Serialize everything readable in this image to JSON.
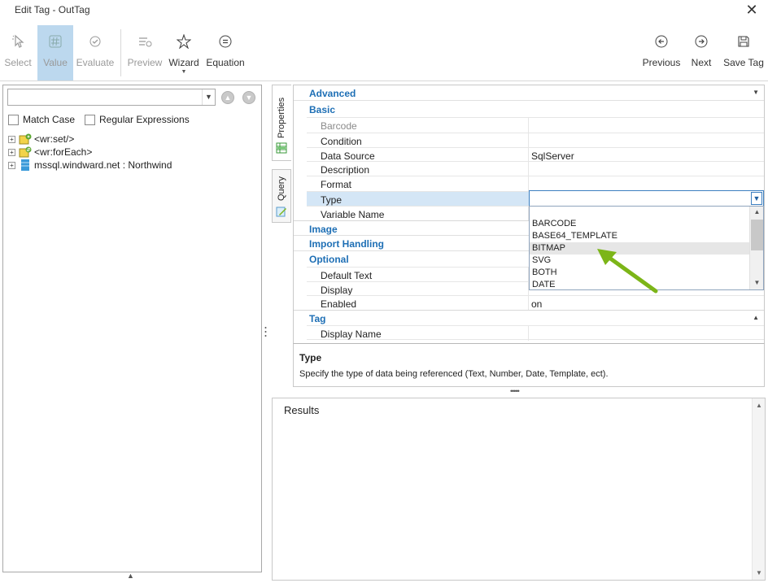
{
  "window": {
    "title": "Edit Tag - OutTag",
    "close_icon": "close-icon"
  },
  "toolbar": {
    "select": {
      "label": "Select",
      "icon": "cursor-icon",
      "state": "disabled"
    },
    "value": {
      "label": "Value",
      "icon": "hash-icon",
      "state": "active"
    },
    "evaluate": {
      "label": "Evaluate",
      "icon": "check-badge-icon",
      "state": "disabled"
    },
    "preview": {
      "label": "Preview",
      "icon": "preview-icon",
      "state": "disabled"
    },
    "wizard": {
      "label": "Wizard",
      "icon": "wizard-star-icon"
    },
    "equation": {
      "label": "Equation",
      "icon": "equals-circle-icon"
    },
    "previous": {
      "label": "Previous",
      "icon": "arrow-left-circle-icon"
    },
    "next": {
      "label": "Next",
      "icon": "arrow-right-circle-icon"
    },
    "save_tag": {
      "label": "Save Tag",
      "icon": "floppy-icon"
    }
  },
  "left": {
    "search_value": "",
    "match_case_label": "Match Case",
    "regex_label": "Regular Expressions",
    "tree": [
      {
        "label": "<wr:set/>",
        "icon": "tag-set-icon"
      },
      {
        "label": "<wr:forEach>",
        "icon": "tag-foreach-icon"
      },
      {
        "label": "mssql.windward.net : Northwind",
        "icon": "database-icon"
      }
    ]
  },
  "side_tabs": {
    "properties": "Properties",
    "query": "Query"
  },
  "grid": {
    "cats": {
      "advanced": "Advanced",
      "basic": "Basic",
      "image": "Image",
      "import_handling": "Import Handling",
      "optional": "Optional",
      "tag": "Tag"
    },
    "basic": {
      "barcode": "Barcode",
      "condition": "Condition",
      "data_source": "Data Source",
      "data_source_value": "SqlServer",
      "description": "Description",
      "format": "Format",
      "type": "Type",
      "variable_name": "Variable Name"
    },
    "optional": {
      "default_text": "Default Text",
      "display": "Display",
      "enabled": "Enabled",
      "enabled_value": "on"
    },
    "tag": {
      "display_name": "Display Name"
    }
  },
  "type_dropdown": {
    "options": [
      "BARCODE",
      "BASE64_TEMPLATE",
      "BITMAP",
      "SVG",
      "BOTH",
      "DATE"
    ],
    "highlighted": "BITMAP"
  },
  "description": {
    "title": "Type",
    "text": "Specify the type of data being referenced (Text, Number, Date, Template, ect)."
  },
  "results": {
    "title": "Results"
  },
  "colors": {
    "accent_blue": "#1e6fb5",
    "active_button": "#bcd8ee",
    "arrow_green": "#7cb518"
  }
}
